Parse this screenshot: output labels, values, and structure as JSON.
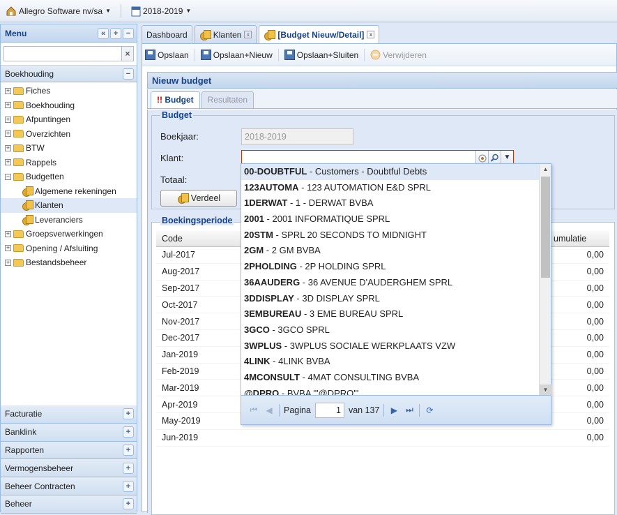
{
  "topbar": {
    "company": "Allegro Software nv/sa",
    "year": "2018-2019"
  },
  "left": {
    "title": "Menu",
    "search_placeholder": "",
    "section": "Boekhouding",
    "tree": [
      {
        "label": "Fiches",
        "level": 1,
        "type": "folder"
      },
      {
        "label": "Boekhouding",
        "level": 1,
        "type": "folder"
      },
      {
        "label": "Afpuntingen",
        "level": 1,
        "type": "folder"
      },
      {
        "label": "Overzichten",
        "level": 1,
        "type": "folder"
      },
      {
        "label": "BTW",
        "level": 1,
        "type": "folder"
      },
      {
        "label": "Rappels",
        "level": 1,
        "type": "folder"
      },
      {
        "label": "Budgetten",
        "level": 1,
        "type": "folder-open"
      },
      {
        "label": "Algemene rekeningen",
        "level": 2,
        "type": "coin"
      },
      {
        "label": "Klanten",
        "level": 2,
        "type": "coin",
        "selected": true
      },
      {
        "label": "Leveranciers",
        "level": 2,
        "type": "coin"
      },
      {
        "label": "Groepsverwerkingen",
        "level": 1,
        "type": "folder"
      },
      {
        "label": "Opening / Afsluiting",
        "level": 1,
        "type": "folder"
      },
      {
        "label": "Bestandsbeheer",
        "level": 1,
        "type": "folder"
      }
    ],
    "accordion": [
      "Facturatie",
      "Banklink",
      "Rapporten",
      "Vermogensbeheer",
      "Beheer Contracten",
      "Beheer"
    ]
  },
  "tabs": [
    {
      "label": "Dashboard"
    },
    {
      "label": "Klanten"
    },
    {
      "label": "[Budget Nieuw/Detail]"
    }
  ],
  "toolbar": {
    "save": "Opslaan",
    "save_new": "Opslaan+Nieuw",
    "save_close": "Opslaan+Sluiten",
    "delete": "Verwijderen"
  },
  "panel": {
    "title": "Nieuw budget",
    "tab_budget": "!! Budget",
    "tab_results": "Resultaten"
  },
  "form": {
    "legend": "Budget",
    "boekjaar_label": "Boekjaar:",
    "boekjaar_value": "2018-2019",
    "klant_label": "Klant:",
    "totaal_label": "Totaal:",
    "verdeel": "Verdeel"
  },
  "periods": {
    "legend": "Boekingsperiode",
    "col_code": "Code",
    "col_cum": "umulatie",
    "rows": [
      {
        "code": "Jul-2017",
        "value": "0,00"
      },
      {
        "code": "Aug-2017",
        "value": "0,00"
      },
      {
        "code": "Sep-2017",
        "value": "0,00"
      },
      {
        "code": "Oct-2017",
        "value": "0,00"
      },
      {
        "code": "Nov-2017",
        "value": "0,00"
      },
      {
        "code": "Dec-2017",
        "value": "0,00"
      },
      {
        "code": "Jan-2019",
        "value": "0,00"
      },
      {
        "code": "Feb-2019",
        "value": "0,00"
      },
      {
        "code": "Mar-2019",
        "value": "0,00"
      },
      {
        "code": "Apr-2019",
        "value": "0,00"
      },
      {
        "code": "May-2019",
        "value": "0,00"
      },
      {
        "code": "Jun-2019",
        "value": "0,00"
      }
    ]
  },
  "dropdown": {
    "items": [
      {
        "code": "00-DOUBTFUL",
        "name": "Customers - Doubtful Debts"
      },
      {
        "code": "123AUTOMA",
        "name": "123 AUTOMATION E&D SPRL"
      },
      {
        "code": "1DERWAT",
        "name": "1 - DERWAT BVBA"
      },
      {
        "code": "2001",
        "name": "2001 INFORMATIQUE SPRL"
      },
      {
        "code": "20STM",
        "name": "SPRL 20 SECONDS TO MIDNIGHT"
      },
      {
        "code": "2GM",
        "name": "2 GM BVBA"
      },
      {
        "code": "2PHOLDING",
        "name": "2P HOLDING SPRL"
      },
      {
        "code": "36AAUDERG",
        "name": "36 AVENUE D'AUDERGHEM SPRL"
      },
      {
        "code": "3DDISPLAY",
        "name": "3D DISPLAY SPRL"
      },
      {
        "code": "3EMBUREAU",
        "name": "3 EME BUREAU SPRL"
      },
      {
        "code": "3GCO",
        "name": "3GCO SPRL"
      },
      {
        "code": "3WPLUS",
        "name": "3WPLUS SOCIALE WERKPLAATS VZW"
      },
      {
        "code": "4LINK",
        "name": "4LINK BVBA"
      },
      {
        "code": "4MCONSULT",
        "name": "4MAT CONSULTING BVBA"
      },
      {
        "code": "@DPRO",
        "name": "BVBA '\"@DPRO\"'"
      }
    ],
    "pager_label": "Pagina",
    "page": "1",
    "of": "van 137"
  }
}
